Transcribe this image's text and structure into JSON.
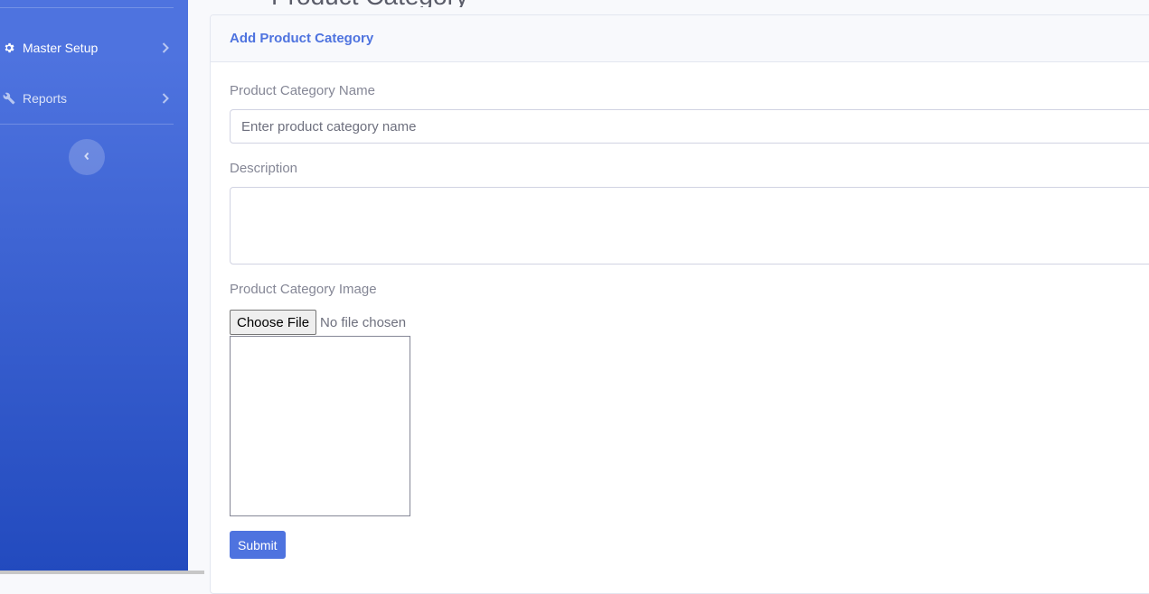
{
  "sidebar": {
    "items": [
      {
        "label": "Master Setup",
        "icon": "gear-icon"
      },
      {
        "label": "Reports",
        "icon": "wrench-icon"
      }
    ],
    "toggle_icon": "chevron-left-icon",
    "gradient_top": "#4e73df",
    "gradient_bottom": "#224abe"
  },
  "page": {
    "heading": "Product Category"
  },
  "card": {
    "title": "Add Product Category",
    "category_name_label": "Product Category Name",
    "category_name_placeholder": "Enter product category name",
    "category_name_value": "",
    "description_label": "Description",
    "description_value": "",
    "image_label": "Product Category Image",
    "choose_file_label": "Choose File",
    "file_status": "No file chosen",
    "submit_label": "Submit",
    "accent_color": "#4e73df"
  }
}
